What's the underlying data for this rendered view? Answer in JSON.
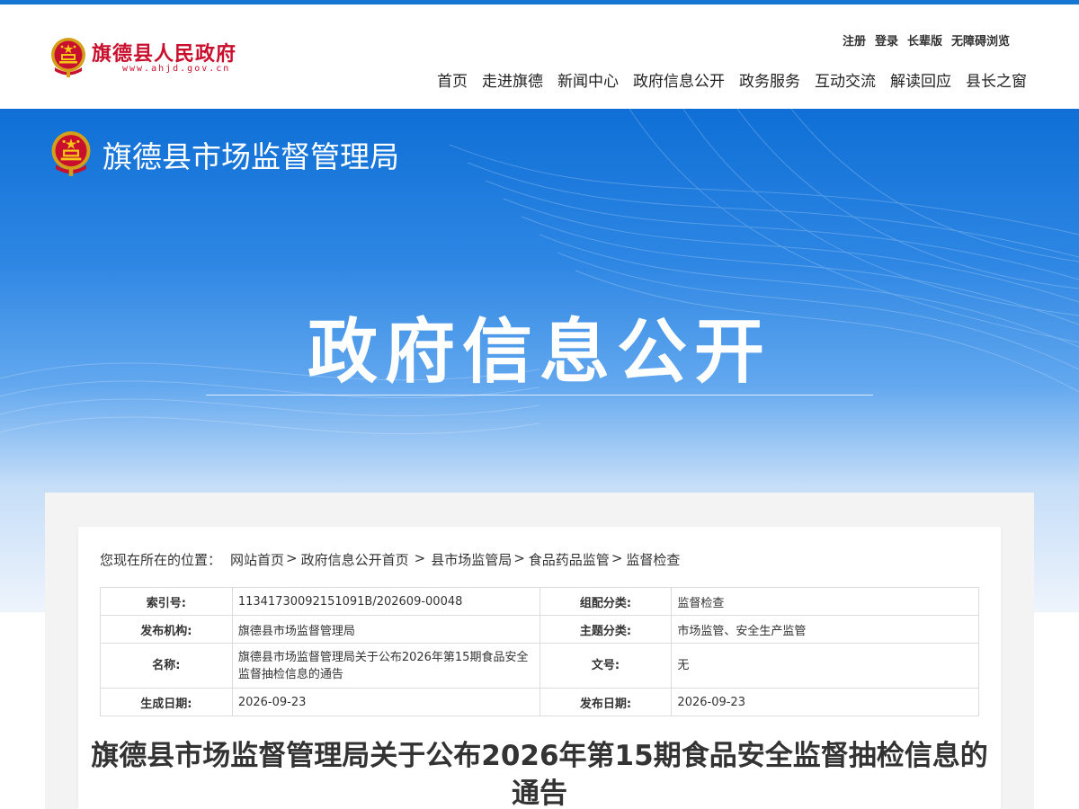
{
  "site": {
    "title": "旗德县人民政府",
    "url": "www.ahjd.gov.cn"
  },
  "utility_links": [
    "注册",
    "登录",
    "长辈版",
    "无障碍浏览"
  ],
  "main_nav": [
    "首页",
    "走进旗德",
    "新闻中心",
    "政府信息公开",
    "政务服务",
    "互动交流",
    "解读回应",
    "县长之窗"
  ],
  "banner": {
    "department": "旗德县市场监督管理局",
    "heading": "政府信息公开"
  },
  "breadcrumb": {
    "prefix": "您现在所在的位置：",
    "items": [
      "网站首页",
      "政府信息公开首页",
      "县市场监管局",
      "食品药品监管",
      "监督检查"
    ],
    "separators": [
      ">",
      "  >",
      ">",
      ">"
    ]
  },
  "metadata": {
    "index_label": "索引号:",
    "index_value": "11341730092151091B/202609-00048",
    "category_label": "组配分类:",
    "category_value": "监督检查",
    "publisher_label": "发布机构:",
    "publisher_value": "旗德县市场监督管理局",
    "topic_label": "主题分类:",
    "topic_value": "市场监管、安全生产监管",
    "name_label": "名称:",
    "name_value": "旗德县市场监督管理局关于公布2026年第15期食品安全监督抽检信息的通告",
    "docno_label": "文号:",
    "docno_value": "无",
    "created_label": "生成日期:",
    "created_value": "2026-09-23",
    "published_label": "发布日期:",
    "published_value": "2026-09-23"
  },
  "document": {
    "title": "旗德县市场监督管理局关于公布2026年第15期食品安全监督抽检信息的通告"
  },
  "colors": {
    "brand_red": "#c8102e",
    "banner_blue": "#0f6fd6",
    "top_bar": "#1677d3"
  }
}
